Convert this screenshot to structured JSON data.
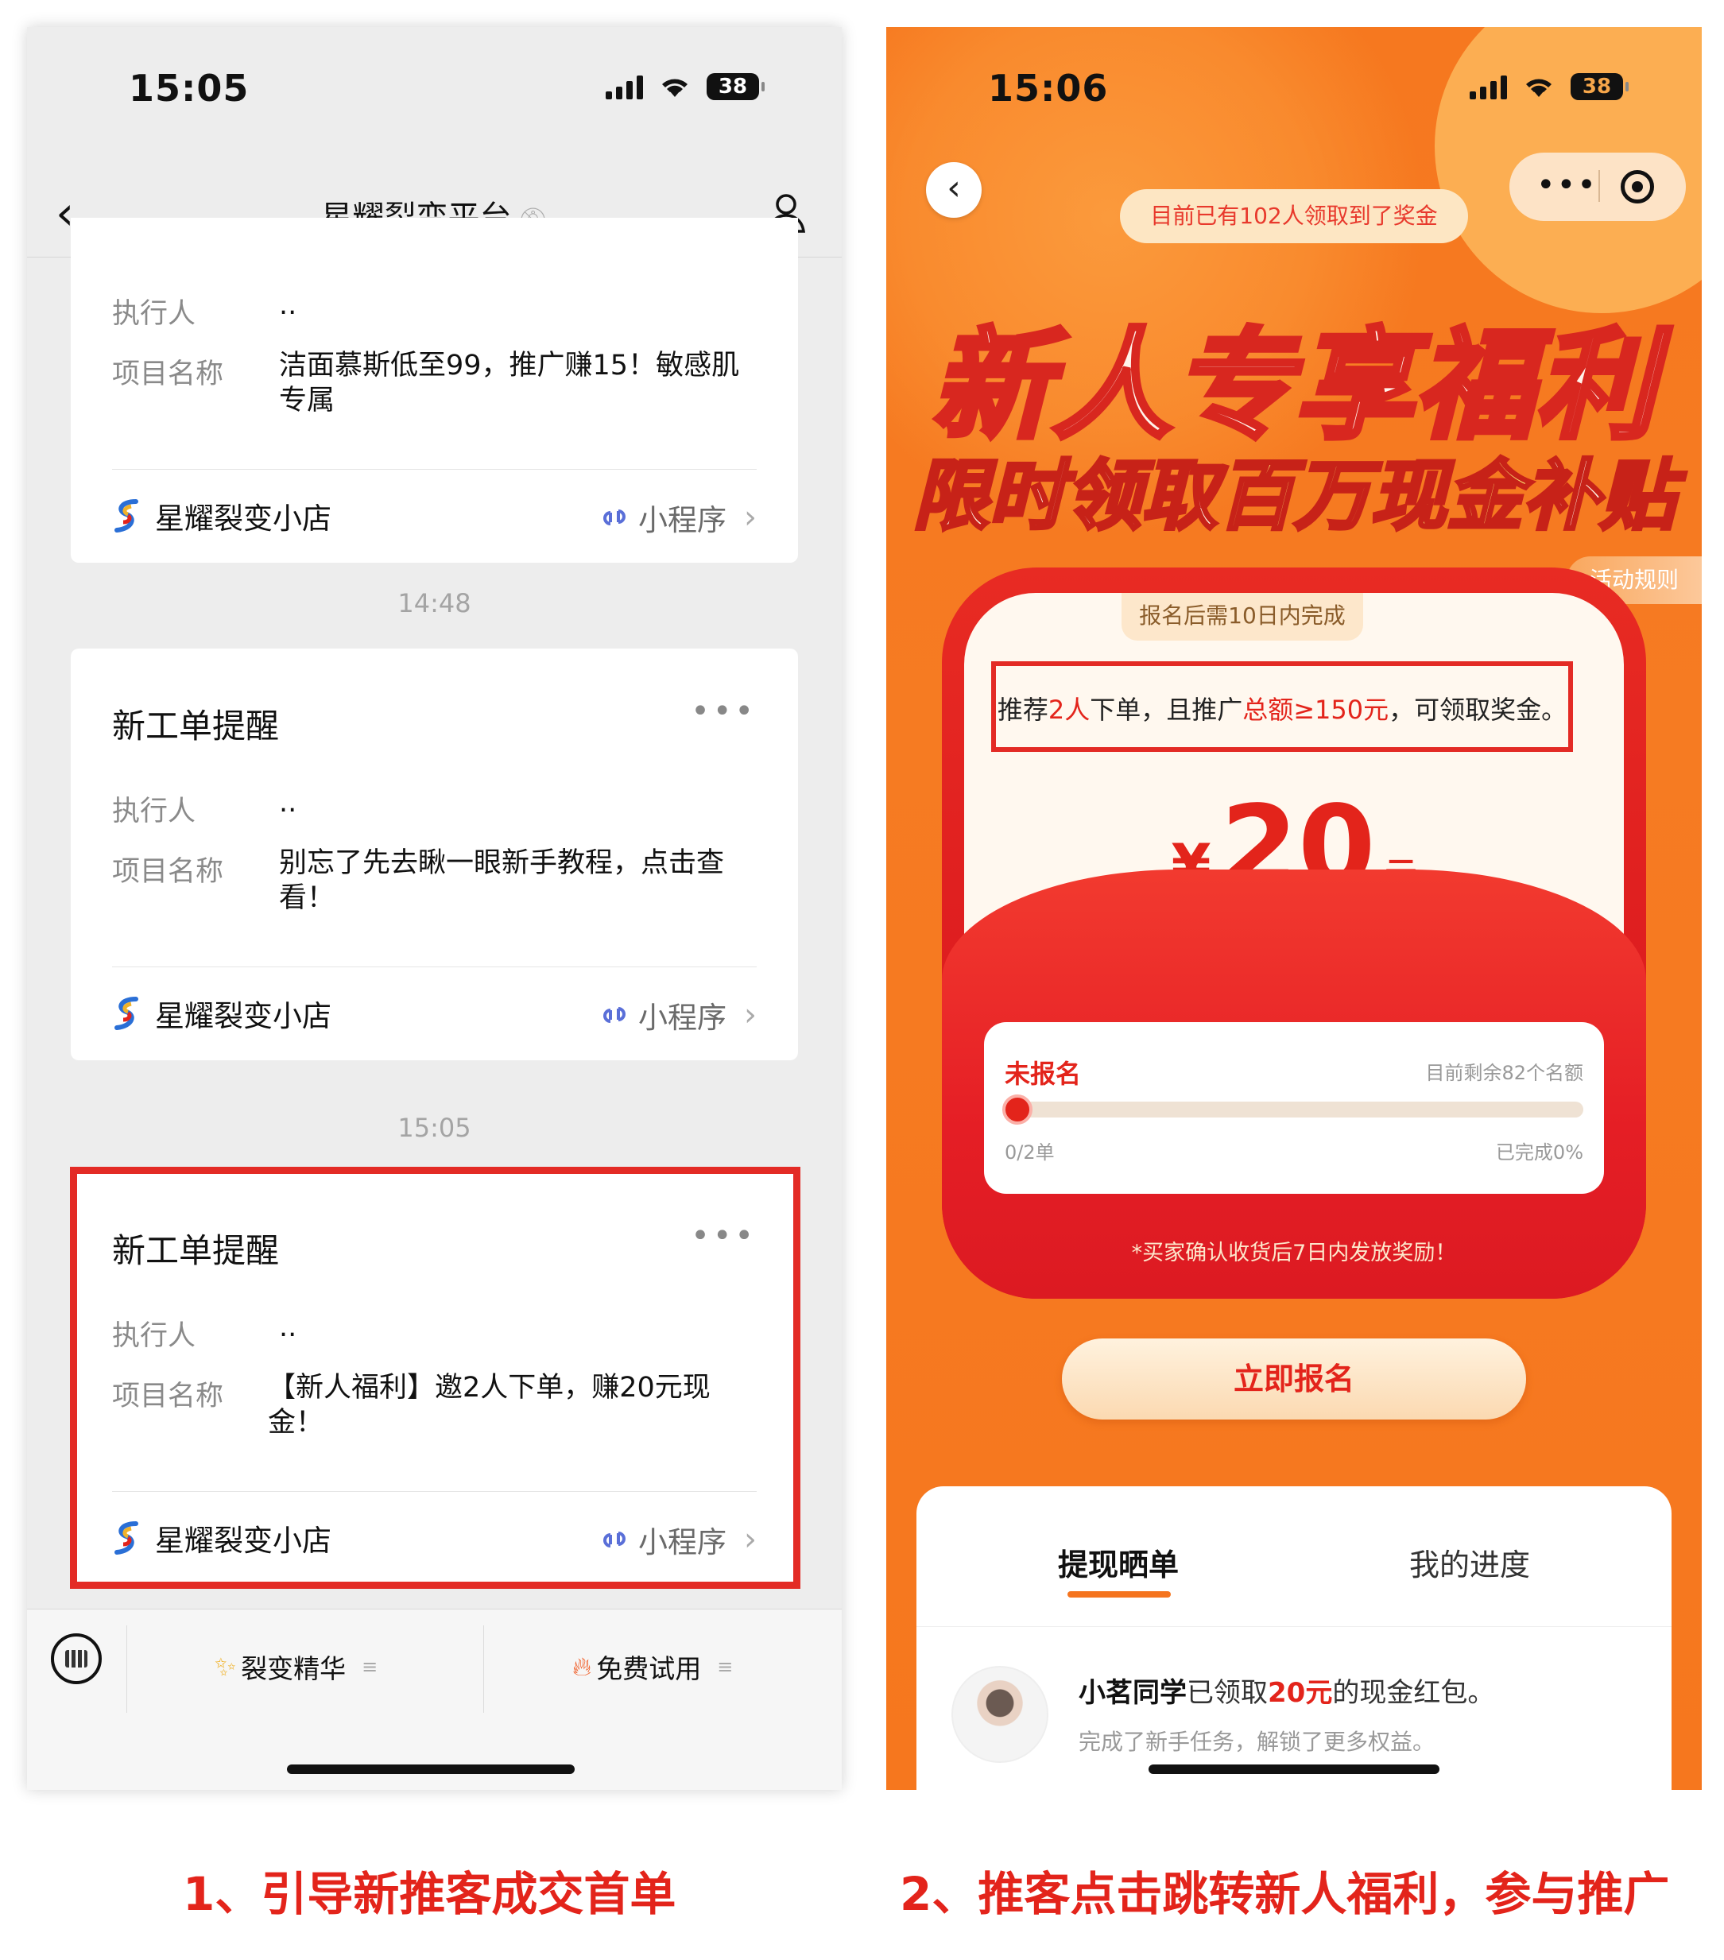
{
  "left": {
    "status_time": "15:05",
    "battery": "38",
    "nav_title": "星耀裂变平台",
    "cards": [
      {
        "title": "",
        "executor_label": "执行人",
        "executor_value": "..",
        "project_label": "项目名称",
        "project_value": "洁面慕斯低至99，推广赚15！敏感肌专属",
        "shop_name": "星耀裂变小店",
        "mini_label": "小程序"
      },
      {
        "title": "新工单提醒",
        "executor_label": "执行人",
        "executor_value": "..",
        "project_label": "项目名称",
        "project_value": "别忘了先去瞅一眼新手教程，点击查看！",
        "shop_name": "星耀裂变小店",
        "mini_label": "小程序"
      },
      {
        "title": "新工单提醒",
        "executor_label": "执行人",
        "executor_value": "..",
        "project_label": "项目名称",
        "project_value": "【新人福利】邀2人下单，赚20元现金！",
        "shop_name": "星耀裂变小店",
        "mini_label": "小程序"
      }
    ],
    "timestamps": [
      "14:48",
      "15:05"
    ],
    "more_glyph": "•••",
    "tabbar": {
      "tab1": "裂变精华",
      "tab2": "免费试用",
      "tab1_icon": "sparkles-icon",
      "tab2_icon": "fire-icon"
    }
  },
  "right": {
    "status_time": "15:06",
    "battery": "38",
    "notice": "目前已有102人领取到了奖金",
    "headline1": "新人专享福利",
    "headline2_a": "限时领取",
    "headline2_b": "百万现金",
    "headline2_c": "补贴",
    "rules_label": "活动规则",
    "envelope_tag": "报名后需10日内完成",
    "condition": {
      "p1": "推荐",
      "p2": "2人",
      "p3": "下单，且推广",
      "p4": "总额≥150元",
      "p5": "，可领取奖金。"
    },
    "amount": {
      "currency": "¥",
      "value": "20",
      "unit": "元"
    },
    "progress": {
      "status": "未报名",
      "remaining": "目前剩余82个名额",
      "count_label": "0/2单",
      "percent_label": "已完成0%",
      "fraction": 0.0
    },
    "envelope_note": "*买家确认收货后7日内发放奖励！",
    "cta_label": "立即报名",
    "tabs": [
      "提现晒单",
      "我的进度"
    ],
    "feed": {
      "name": "小茗同学",
      "text1": "已领取",
      "amount": "20元",
      "text2": "的现金红包。",
      "sub": "完成了新手任务，解锁了更多权益。"
    }
  },
  "captions": {
    "left": "1、引导新推客成交首单",
    "right": "2、推客点击跳转新人福利，参与推广"
  },
  "colors": {
    "accent_red": "#e3241b",
    "orange": "#f6781f",
    "highlight_box": "#e32b25"
  }
}
